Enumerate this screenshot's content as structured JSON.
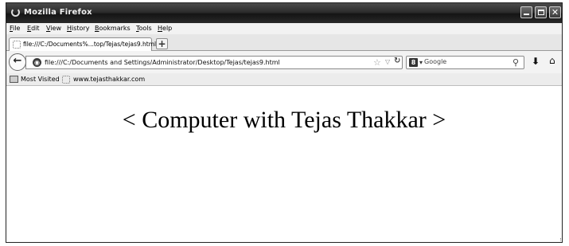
{
  "window": {
    "title": "Mozilla Firefox"
  },
  "menu": {
    "items": [
      "File",
      "Edit",
      "View",
      "History",
      "Bookmarks",
      "Tools",
      "Help"
    ]
  },
  "tabs": {
    "active_label": "file:///C:/Documents%...top/Tejas/tejas9.html",
    "new_tab_label": "+"
  },
  "navigation": {
    "url": "file:///C:/Documents and Settings/Administrator/Desktop/Tejas/tejas9.html",
    "search_placeholder": "Google"
  },
  "bookmarks": {
    "items": [
      "Most Visited",
      "www.tejasthakkar.com"
    ]
  },
  "page": {
    "heading": "< Computer with Tejas Thakkar >"
  },
  "icons": {
    "back": "back-arrow-icon",
    "site": "site-identity-icon",
    "star": "bookmark-star-icon",
    "reload": "reload-icon",
    "search_engine": "search-engine-icon",
    "magnifier": "magnifier-icon",
    "download": "download-icon",
    "home": "home-icon"
  }
}
